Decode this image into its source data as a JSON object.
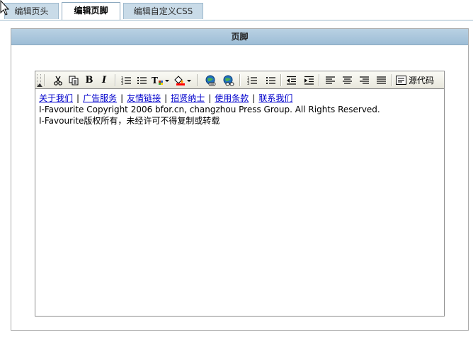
{
  "tabs": [
    {
      "label": "编辑页头",
      "active": false
    },
    {
      "label": "编辑页脚",
      "active": true
    },
    {
      "label": "编辑自定义CSS",
      "active": false
    }
  ],
  "panel": {
    "title": "页脚"
  },
  "toolbar": {
    "source_label": "源代码",
    "icons": [
      "cut-icon",
      "copy-icon",
      "bold-icon",
      "italic-icon",
      "ordered-list-icon",
      "unordered-list-icon",
      "font-size-dropdown-icon",
      "color-dropdown-icon",
      "link-icon",
      "unlink-icon",
      "ordered-list-icon",
      "unordered-list-icon",
      "outdent-icon",
      "indent-icon",
      "align-left-icon",
      "align-center-icon",
      "align-right-icon",
      "justify-icon",
      "source-code-icon"
    ],
    "bold_glyph": "B",
    "italic_glyph": "I"
  },
  "footer_content": {
    "links": [
      "关于我们",
      "广告服务",
      "友情链接",
      "招贤纳士",
      "使用条款",
      "联系我们"
    ],
    "separator": "|",
    "copyright_line": "I-Favourite Copyright 2006 bfor.cn, changzhou Press Group. All Rights Reserved.",
    "notice_line": "I-Favourite版权所有，未经许可不得复制或转载"
  },
  "colors": {
    "tab_bg": "#c9dbe8",
    "header_bg": "#a9c6dc",
    "link": "#0000cc",
    "toolbar_bg": "#eeede3"
  }
}
